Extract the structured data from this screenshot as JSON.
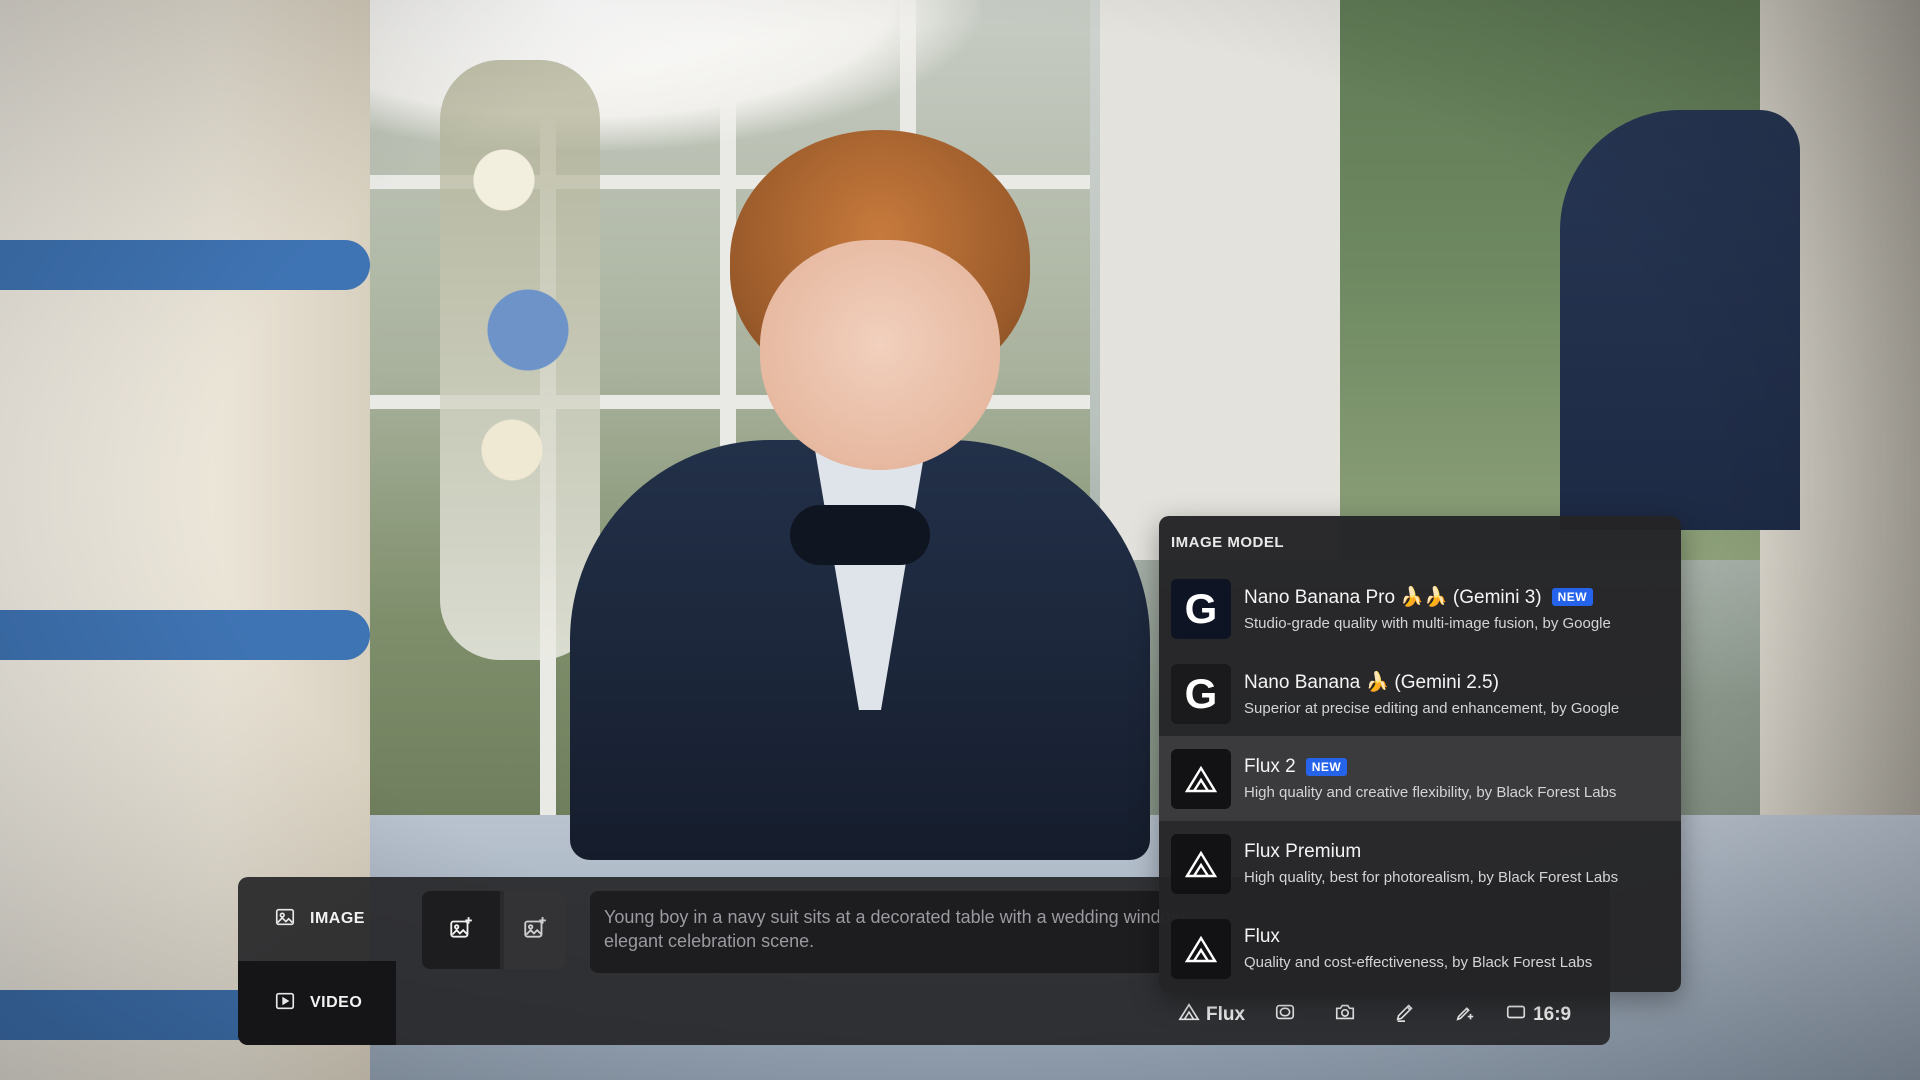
{
  "modes": {
    "image_label": "IMAGE",
    "video_label": "VIDEO"
  },
  "prompt": {
    "text": "Young boy in a navy suit sits at a decorated table with a wedding window, elegant celebration scene."
  },
  "dropdown": {
    "header": "IMAGE MODEL",
    "badge_label": "NEW",
    "items": [
      {
        "title": "Nano Banana Pro 🍌🍌 (Gemini 3)",
        "desc": "Studio-grade quality with multi-image fusion, by Google",
        "badge": "NEW",
        "logo": "google-g-icon",
        "selected": false
      },
      {
        "title": "Nano Banana 🍌 (Gemini 2.5)",
        "desc": "Superior at precise editing and enhancement, by Google",
        "logo": "google-g-icon",
        "selected": false
      },
      {
        "title": "Flux 2",
        "desc": "High quality and creative flexibility, by Black Forest Labs",
        "badge": "NEW",
        "logo": "flux-triangle-icon",
        "selected": true
      },
      {
        "title": "Flux Premium",
        "desc": "High quality, best for photorealism, by Black Forest Labs",
        "logo": "flux-triangle-icon",
        "selected": false
      },
      {
        "title": "Flux",
        "desc": "Quality and cost-effectiveness, by Black Forest Labs",
        "logo": "flux-triangle-icon",
        "selected": false
      }
    ]
  },
  "tools": {
    "model_label": "Flux",
    "aspect_label": "16:9"
  },
  "colors": {
    "accent_badge": "#2563eb",
    "panel_bg": "#262628",
    "selected_row": "#3b3b3e"
  }
}
